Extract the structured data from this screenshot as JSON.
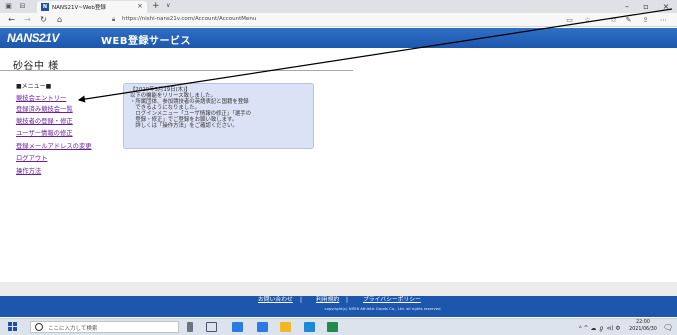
{
  "browser": {
    "tab_title": "NANS21V~Web登録",
    "tab_favicon": "N",
    "tab_close_glyph": "×",
    "new_tab_glyph": "+",
    "tab_list_glyph": "∨",
    "url": "https://nishi-nans21v.com/Account/AccountMenu",
    "win_min": "–",
    "win_max": "▫",
    "win_close": "×"
  },
  "site": {
    "logo": "NANS21V",
    "service_name": "WEB登録サービス",
    "user_name": "砂谷中 様"
  },
  "menu": {
    "title": "■メニュー■",
    "items": [
      "競技会エントリー",
      "登録済み競技会一覧",
      "競技者の登録・修正",
      "ユーザー情報の修正",
      "登録メールアドレスの変更",
      "ログアウト",
      "操作方法"
    ]
  },
  "notice": {
    "lines": [
      "【2020年3月19日(木)】",
      "以下の機能をリリース致しました。",
      "・所属団体、参加競技者の英語表記と国籍を登録",
      "　できるようになりました。",
      "　ログインメニュー「ユーザ情報の修正」「選手の",
      "　登録・修正」でご登録をお願い致します。",
      "　詳しくは「操作方法」をご確認ください。"
    ]
  },
  "footer": {
    "links": [
      "お問い合わせ",
      "利用規約",
      "プライバシーポリシー"
    ],
    "separator": "|",
    "copyright": "copyright(c) NISHI Athletic Goods Co., Ltd. all rights reserved"
  },
  "taskbar": {
    "search_placeholder": "ここに入力して検索",
    "tray": "ᴬ  ^  ☁  ℊ  ⊲)  Φ",
    "time": "22:00",
    "date": "2021/06/30"
  },
  "colors": {
    "header_blue": "#1c57ad",
    "menu_link": "#6a1f9c",
    "notice_bg": "#dbe2f5"
  }
}
